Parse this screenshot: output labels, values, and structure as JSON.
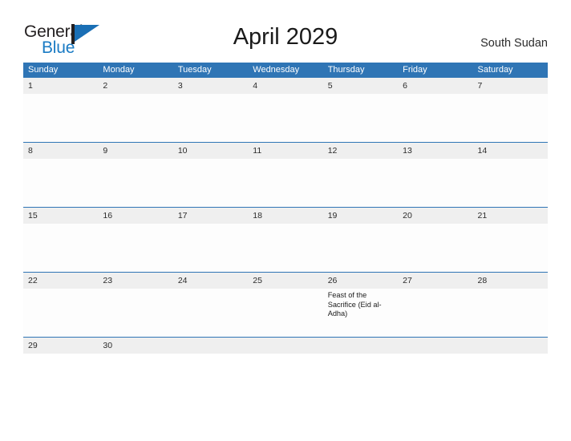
{
  "brand": {
    "name_part1": "General",
    "name_part2": "Blue",
    "mark": "flag-triangle-icon",
    "color_dark": "#231f20",
    "color_blue": "#1a7bc4"
  },
  "header": {
    "title": "April 2029",
    "region": "South Sudan"
  },
  "theme": {
    "header_blue": "#2f75b5",
    "band_gray": "#efefef",
    "text_dark": "#2b2b2b"
  },
  "calendar": {
    "month": "April",
    "year": "2029",
    "weekdays": [
      "Sunday",
      "Monday",
      "Tuesday",
      "Wednesday",
      "Thursday",
      "Friday",
      "Saturday"
    ],
    "weeks": [
      {
        "days": [
          {
            "num": "1",
            "events": []
          },
          {
            "num": "2",
            "events": []
          },
          {
            "num": "3",
            "events": []
          },
          {
            "num": "4",
            "events": []
          },
          {
            "num": "5",
            "events": []
          },
          {
            "num": "6",
            "events": []
          },
          {
            "num": "7",
            "events": []
          }
        ]
      },
      {
        "days": [
          {
            "num": "8",
            "events": []
          },
          {
            "num": "9",
            "events": []
          },
          {
            "num": "10",
            "events": []
          },
          {
            "num": "11",
            "events": []
          },
          {
            "num": "12",
            "events": []
          },
          {
            "num": "13",
            "events": []
          },
          {
            "num": "14",
            "events": []
          }
        ]
      },
      {
        "days": [
          {
            "num": "15",
            "events": []
          },
          {
            "num": "16",
            "events": []
          },
          {
            "num": "17",
            "events": []
          },
          {
            "num": "18",
            "events": []
          },
          {
            "num": "19",
            "events": []
          },
          {
            "num": "20",
            "events": []
          },
          {
            "num": "21",
            "events": []
          }
        ]
      },
      {
        "days": [
          {
            "num": "22",
            "events": []
          },
          {
            "num": "23",
            "events": []
          },
          {
            "num": "24",
            "events": []
          },
          {
            "num": "25",
            "events": []
          },
          {
            "num": "26",
            "events": [
              "Feast of the Sacrifice (Eid al-Adha)"
            ]
          },
          {
            "num": "27",
            "events": []
          },
          {
            "num": "28",
            "events": []
          }
        ]
      },
      {
        "days": [
          {
            "num": "29",
            "events": []
          },
          {
            "num": "30",
            "events": []
          },
          {
            "num": "",
            "events": []
          },
          {
            "num": "",
            "events": []
          },
          {
            "num": "",
            "events": []
          },
          {
            "num": "",
            "events": []
          },
          {
            "num": "",
            "events": []
          }
        ]
      }
    ]
  }
}
